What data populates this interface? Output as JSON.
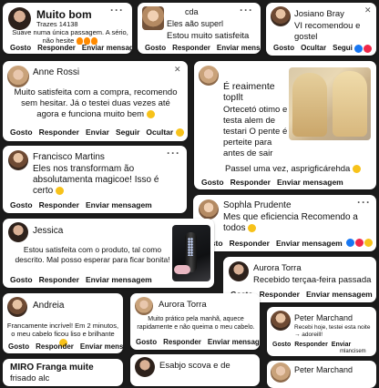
{
  "c1": {
    "name": "Muito bom",
    "sub": "Trazes 14138",
    "text": "Suave numa única passagem. A sério, não hesite",
    "actions": [
      "Gosto",
      "Responder",
      "Enviar mensagem"
    ]
  },
  "c2": {
    "name": "cda",
    "line1": "Eles aão superl",
    "line2": "Estou muito satisfeita",
    "actions": [
      "Gosto",
      "Responder",
      "Enviar mensagem"
    ]
  },
  "c3": {
    "name": "Josiano Bray",
    "text": "VI recomendou e gostel",
    "actions": [
      "Gosto",
      "Ocultar",
      "Segui"
    ]
  },
  "c4": {
    "name": "Anne Rossi",
    "text": "Muito satisfeita com a compra, recomendo sem hesitar. Já o testei duas vezes até agora e funciona muito bem",
    "actions": [
      "Gosto",
      "Responder",
      "Enviar",
      "Seguir",
      "Ocultar"
    ]
  },
  "c5": {
    "l1": "É reaimente",
    "l2": "topIlt",
    "l3": "Ortecetó otimo e testa alem de testari O pente é perteite para antes de sair",
    "l4": "Passel uma vez, asprigficárehda",
    "actions": [
      "Gosto",
      "Responder",
      "Enviar mensagem"
    ]
  },
  "c6": {
    "name": "Francisco Martins",
    "text": "Eles nos transformam ão absolutamenta magicoe! Isso é certo",
    "actions": [
      "Gosto",
      "Responder",
      "Enviar mensagem"
    ]
  },
  "c7": {
    "name": "Sophla Prudente",
    "text": "Mes que eficiencia Recomendo a todos",
    "actions": [
      "Gosto",
      "Responder",
      "Enviar mensagem"
    ]
  },
  "c8": {
    "name": "Jessica",
    "text": "Estou satisfeita com o produto, tal como descrito. Mal posso esperar para ficar bonita!",
    "actions": [
      "Gosto",
      "Responder",
      "Enviar mensagem"
    ]
  },
  "c9": {
    "name": "Aurora Torra",
    "text": "Recebido terçaa-feira passada",
    "actions": [
      "Gosto",
      "Responder",
      "Enviar mensagem"
    ]
  },
  "c10": {
    "name": "Andreia",
    "text": "Francamente incrível! Em 2 minutos, o meu cabelo ficou liso e brilhante",
    "actions": [
      "Gosto",
      "Responder",
      "Enviar mensagem"
    ]
  },
  "c11": {
    "name": "Aurora Torra",
    "text": "Muito prático pela manhã, aquece rapidamente e não queima o meu cabelo.",
    "actions": [
      "Gosto",
      "Responder",
      "Enviar mensagem"
    ]
  },
  "c12": {
    "name": "Peter Marchand",
    "text": "Recebi hoje, testei esta noite → adoreill!",
    "actions": [
      "Gosto",
      "Responder",
      "Enviar",
      "mlancisem"
    ]
  },
  "c13": {
    "name": "MIRO Franga muite",
    "text": "frisado alc"
  },
  "c14": {
    "name": "Esabjo scova e de"
  },
  "c15": {
    "name": "Peter Marchand"
  },
  "colors": {
    "card": "#ffffff",
    "background": "#1b1b1b",
    "like_blue": "#1877f2",
    "heart_red": "#f0284a",
    "fire": "#ff8a00"
  }
}
